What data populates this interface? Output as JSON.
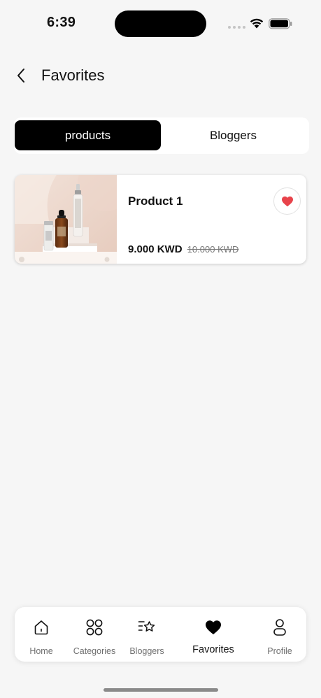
{
  "status_bar": {
    "time": "6:39"
  },
  "header": {
    "title": "Favorites"
  },
  "tabs": {
    "products_label": "products",
    "bloggers_label": "Bloggers",
    "active": "products"
  },
  "favorites": [
    {
      "name": "Product 1",
      "price": "9.000 KWD",
      "old_price": "10.000 KWD",
      "favorited": true
    }
  ],
  "bottom_nav": {
    "active": "favorites",
    "items": [
      {
        "id": "home",
        "label": "Home",
        "icon": "home-icon"
      },
      {
        "id": "categories",
        "label": "Categories",
        "icon": "grid-icon"
      },
      {
        "id": "bloggers",
        "label": "Bloggers",
        "icon": "star-list-icon"
      },
      {
        "id": "favorites",
        "label": "Favorites",
        "icon": "heart-icon"
      },
      {
        "id": "profile",
        "label": "Profile",
        "icon": "person-icon"
      }
    ]
  },
  "colors": {
    "accent": "#000000",
    "heart": "#e8434b",
    "background": "#f6f6f6"
  }
}
